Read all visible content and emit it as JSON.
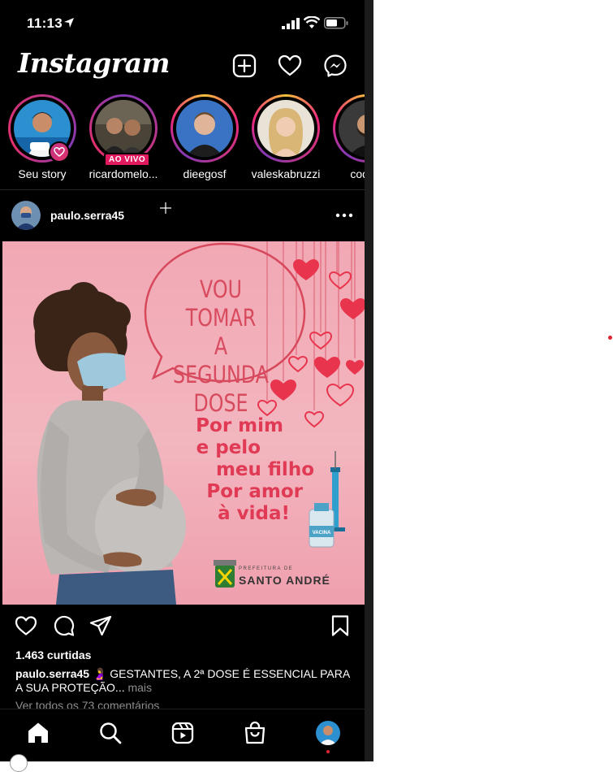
{
  "status_bar": {
    "time": "11:13"
  },
  "header": {
    "logo": "Instagram"
  },
  "stories": [
    {
      "username": "Seu story",
      "live": false,
      "own": true
    },
    {
      "username": "ricardomelo...",
      "live": true,
      "live_label": "AO VIVO"
    },
    {
      "username": "dieegosf",
      "live": false
    },
    {
      "username": "valeskabruzzi",
      "live": false
    },
    {
      "username": "codigo",
      "live": false
    }
  ],
  "post": {
    "username": "paulo.serra45",
    "image": {
      "bubble_text": [
        "VOU TOMAR",
        "A SEGUNDA",
        "DOSE"
      ],
      "slogan": [
        "Por mim",
        "e pelo",
        "meu filho",
        "Por amor",
        "à vida!"
      ],
      "vial_label": "VACINA",
      "brand_sub": "PREFEITURA DE",
      "brand": "SANTO ANDRÉ"
    },
    "likes": "1.463 curtidas",
    "caption_user": "paulo.serra45",
    "caption_text": "🤰 GESTANTES, A 2ª DOSE É ESSENCIAL PARA A SUA PROTEÇÃO...",
    "caption_more": "mais",
    "view_comments": "Ver todos os 73 comentários"
  },
  "colors": {
    "background": "#000000",
    "story_ring": "#ee2a7b",
    "live_badge": "#e1195e",
    "post_pink": "#f1a8b4",
    "slogan_red": "#e03a55"
  }
}
